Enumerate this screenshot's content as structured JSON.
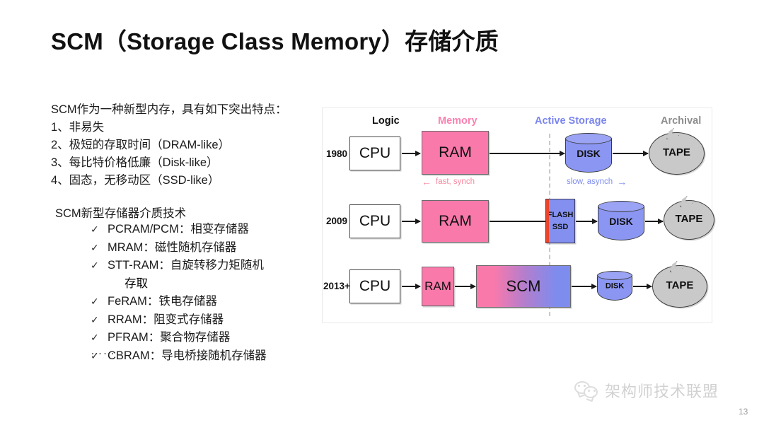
{
  "slide": {
    "title": "SCM（Storage Class Memory）存储介质",
    "page_number": "13"
  },
  "left": {
    "intro_heading": "SCM作为一种新型内存，具有如下突出特点：",
    "intro_items": [
      "1、非易失",
      "2、极短的存取时间（DRAM-like）",
      "3、每比特价格低廉（Disk-like）",
      "4、固态，无移动区（SSD-like）"
    ],
    "tech_heading": "SCM新型存储器介质技术",
    "check_glyph": "✓",
    "tech_items": [
      {
        "label": "PCRAM/PCM：相变存储器",
        "cont": ""
      },
      {
        "label": "MRAM：磁性随机存储器",
        "cont": ""
      },
      {
        "label": "STT-RAM：自旋转移力矩随机",
        "cont": "存取"
      },
      {
        "label": "FeRAM：铁电存储器",
        "cont": ""
      },
      {
        "label": "RRAM：阻变式存储器",
        "cont": ""
      },
      {
        "label": "PFRAM：聚合物存储器",
        "cont": ""
      },
      {
        "label": "CBRAM：导电桥接随机存储器",
        "cont": ""
      }
    ],
    "ellipsis": "……"
  },
  "diagram": {
    "column_headers": [
      {
        "label": "Logic",
        "color": "#0d0d0d"
      },
      {
        "label": "Memory",
        "color": "#FA80B0"
      },
      {
        "label": "Active Storage",
        "color": "#7B85EE"
      },
      {
        "label": "Archival",
        "color": "#8d8d8d"
      }
    ],
    "speed_notes": {
      "fast_arrow": "←",
      "fast_label": "fast, synch",
      "slow_label": "slow, asynch",
      "slow_arrow": "→"
    },
    "rows": [
      {
        "year": "1980",
        "nodes": {
          "cpu": "CPU",
          "ram": "RAM",
          "disk": "DISK",
          "tape": "TAPE"
        }
      },
      {
        "year": "2009",
        "nodes": {
          "cpu": "CPU",
          "ram": "RAM",
          "flash_line1": "FLASH",
          "flash_line2": "SSD",
          "disk": "DISK",
          "tape": "TAPE"
        }
      },
      {
        "year": "2013+",
        "nodes": {
          "cpu": "CPU",
          "ram": "RAM",
          "scm": "SCM",
          "disk": "DISK",
          "tape": "TAPE"
        }
      }
    ],
    "colors": {
      "memory_pink": "#FA79AB",
      "storage_blue": "#8B96F2",
      "archival_gray": "#C9C9C9",
      "flash_stripe_red": "#E8452F"
    }
  },
  "footer": {
    "watermark_text": "架构师技术联盟",
    "watermark_icon": "wechat-icon"
  }
}
